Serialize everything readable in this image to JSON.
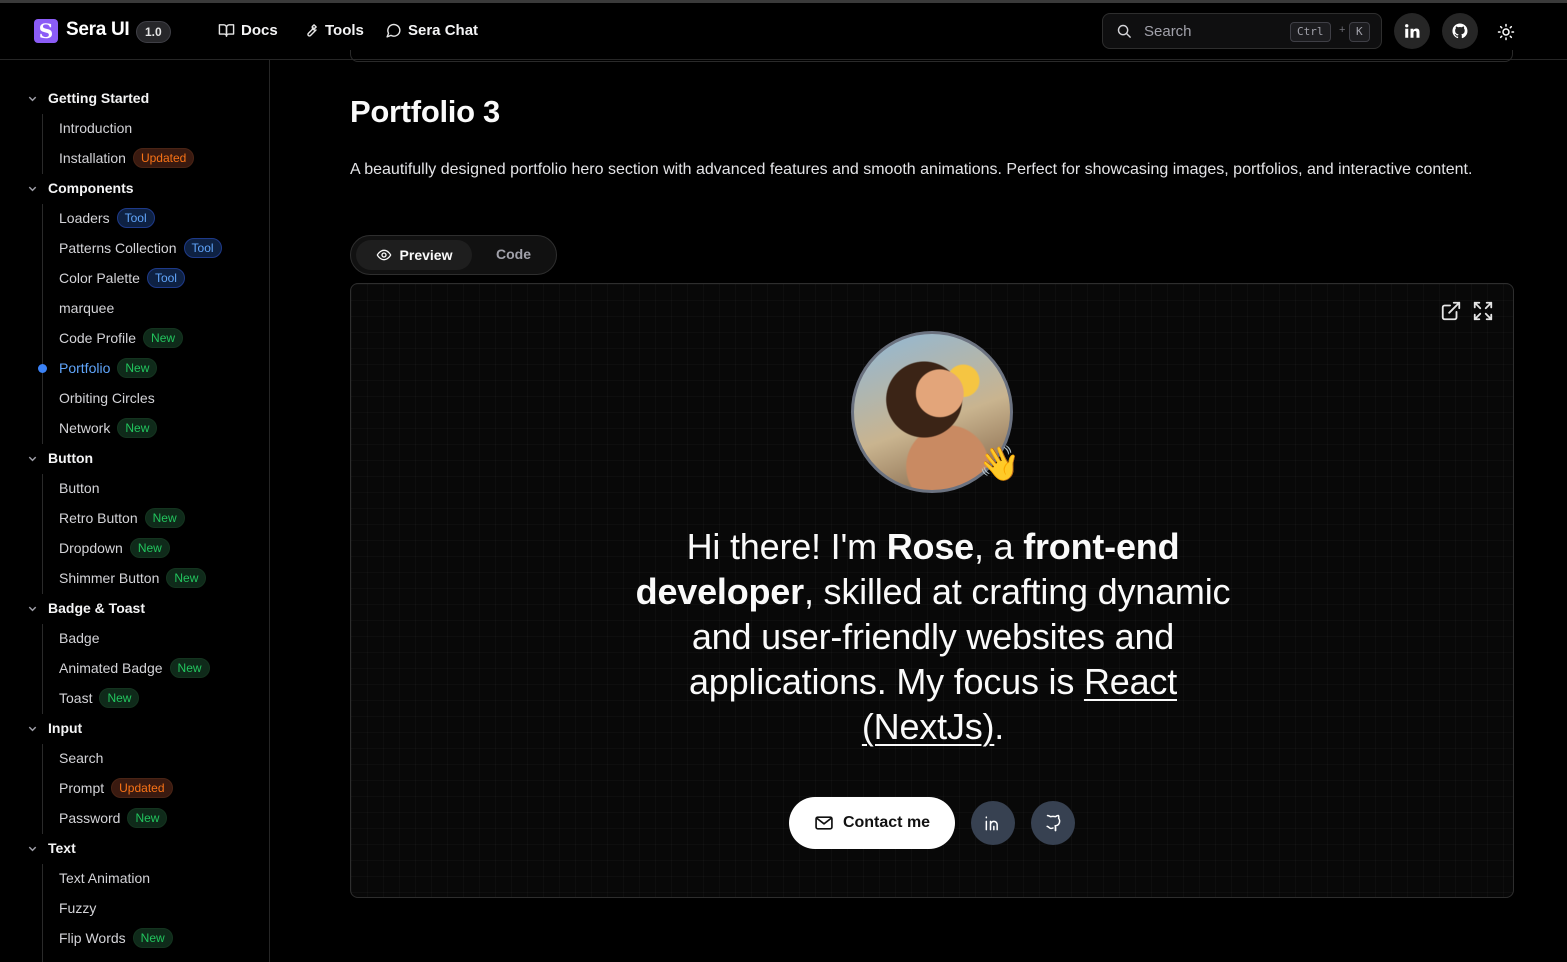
{
  "header": {
    "logo_letter": "S",
    "brand": "Sera UI",
    "version": "1.0",
    "nav": [
      {
        "label": "Docs",
        "icon": "book-icon"
      },
      {
        "label": "Tools",
        "icon": "wrench-icon"
      },
      {
        "label": "Sera Chat",
        "icon": "chat-bubble-icon"
      }
    ],
    "search": {
      "placeholder": "Search",
      "kbd_ctrl": "Ctrl",
      "kbd_plus": "+",
      "kbd_key": "K"
    },
    "icons": [
      "linkedin-icon",
      "github-icon",
      "sun-icon"
    ]
  },
  "sidebar": {
    "sections": [
      {
        "title": "Getting Started",
        "items": [
          {
            "label": "Introduction",
            "badge": ""
          },
          {
            "label": "Installation",
            "badge": "Updated"
          }
        ]
      },
      {
        "title": "Components",
        "items": [
          {
            "label": "Loaders",
            "badge": "Tool"
          },
          {
            "label": "Patterns Collection",
            "badge": "Tool"
          },
          {
            "label": "Color Palette",
            "badge": "Tool"
          },
          {
            "label": "marquee",
            "badge": ""
          },
          {
            "label": "Code Profile",
            "badge": "New"
          },
          {
            "label": "Portfolio",
            "badge": "New",
            "active": true
          },
          {
            "label": "Orbiting Circles",
            "badge": ""
          },
          {
            "label": "Network",
            "badge": "New"
          }
        ]
      },
      {
        "title": "Button",
        "items": [
          {
            "label": "Button",
            "badge": ""
          },
          {
            "label": "Retro Button",
            "badge": "New"
          },
          {
            "label": "Dropdown",
            "badge": "New"
          },
          {
            "label": "Shimmer Button",
            "badge": "New"
          }
        ]
      },
      {
        "title": "Badge & Toast",
        "items": [
          {
            "label": "Badge",
            "badge": ""
          },
          {
            "label": "Animated Badge",
            "badge": "New"
          },
          {
            "label": "Toast",
            "badge": "New"
          }
        ]
      },
      {
        "title": "Input",
        "items": [
          {
            "label": "Search",
            "badge": ""
          },
          {
            "label": "Prompt",
            "badge": "Updated"
          },
          {
            "label": "Password",
            "badge": "New"
          }
        ]
      },
      {
        "title": "Text",
        "items": [
          {
            "label": "Text Animation",
            "badge": ""
          },
          {
            "label": "Fuzzy",
            "badge": ""
          },
          {
            "label": "Flip Words",
            "badge": "New"
          }
        ]
      }
    ]
  },
  "main": {
    "title": "Portfolio 3",
    "description": "A beautifully designed portfolio hero section with advanced features and smooth animations. Perfect for showcasing images, portfolios, and interactive content.",
    "tabs": {
      "preview": "Preview",
      "code": "Code"
    },
    "preview": {
      "wave_emoji": "👋",
      "hero": {
        "p1": "Hi there! I'm ",
        "name": "Rose",
        "p2": ", a ",
        "role": "front-end developer",
        "p3": ", skilled at crafting dynamic and user-friendly websites and applications. My focus is ",
        "focus": "React (NextJs)",
        "p4": "."
      },
      "contact_label": "Contact me",
      "icons": [
        "external-link-icon",
        "fullscreen-icon",
        "mail-icon",
        "linkedin-icon",
        "github-icon"
      ]
    }
  },
  "colors": {
    "accent": "#8b5cf6",
    "active_link": "#60a5fa",
    "badge_updated": "#f97316",
    "badge_tool": "#60a5fa",
    "badge_new": "#22c55e"
  }
}
